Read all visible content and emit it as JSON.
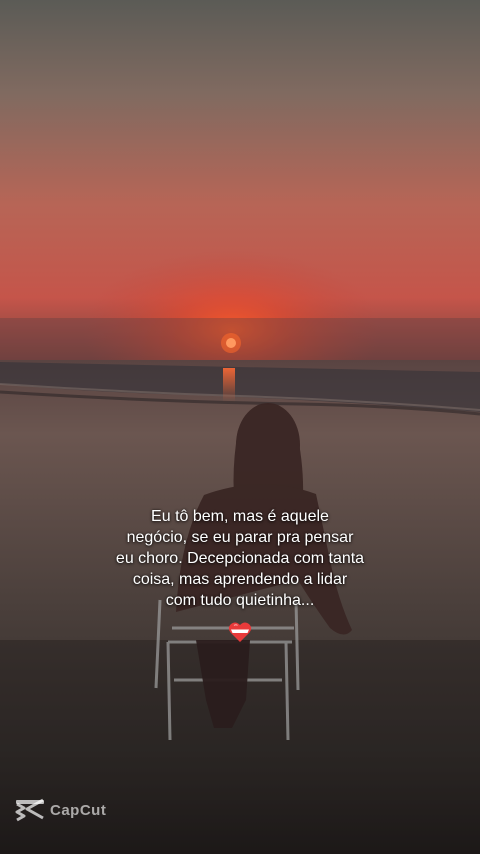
{
  "caption": {
    "lines": [
      "Eu tô bem, mas é aquele",
      "negócio, se eu parar pra pensar",
      "eu choro. Decepcionada com tanta",
      "coisa, mas aprendendo a lidar",
      "com tudo quietinha..."
    ],
    "emoji": "heart-emoji"
  },
  "watermark": {
    "brand": "CapCut",
    "icon": "capcut-logo-icon"
  },
  "colors": {
    "sky_top": "#5d5c58",
    "sky_glow": "#c9584a",
    "sun": "#ff5a1f",
    "sea": "#3b3430",
    "text": "#ffffff"
  }
}
